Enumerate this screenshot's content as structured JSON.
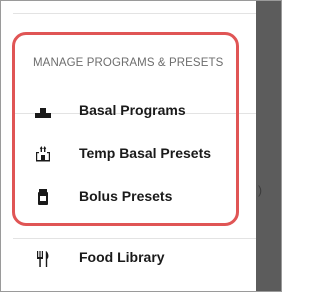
{
  "menu": {
    "section_title": "MANAGE PROGRAMS & PRESETS",
    "items": [
      {
        "label": "Basal Programs",
        "icon": "basal-program-icon"
      },
      {
        "label": "Temp Basal Presets",
        "icon": "temp-basal-icon"
      },
      {
        "label": "Bolus Presets",
        "icon": "bolus-vial-icon"
      }
    ],
    "food": {
      "label": "Food Library",
      "icon": "fork-knife-icon"
    }
  },
  "scrim": {
    "visible_fragment": ")"
  },
  "colors": {
    "highlight": "#e05555",
    "scrim": "#5c5c5c",
    "section_title": "#6d6d6d",
    "item_text": "#1a1a1a"
  }
}
